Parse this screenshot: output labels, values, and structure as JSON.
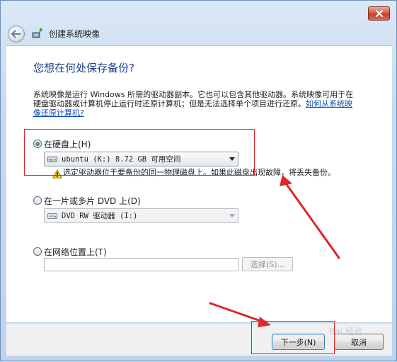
{
  "window": {
    "title": "创建系统映像",
    "close_icon": "close-x-icon"
  },
  "page": {
    "heading": "您想在何处保存备份?",
    "description": "系统映像是运行 Windows 所需的驱动器副本。它也可以包含其他驱动器。系统映像可用于在硬盘驱动器或计算机停止运行时还原计算机；但是无法选择单个项目进行还原。",
    "description_link": "如何从系统映像还原计算机?"
  },
  "options": {
    "hard_disk": {
      "label": "在硬盘上(H)",
      "checked": true,
      "selected_drive": "ubuntu (K:)  8.72 GB 可用空间",
      "drive_icon": "hard-drive-icon"
    },
    "warning": {
      "icon": "warning-icon",
      "text": "选定驱动器位于要备份的同一物理磁盘上。如果此磁盘出现故障，将丢失备份。"
    },
    "dvd": {
      "label": "在一片或多片 DVD 上(D)",
      "checked": false,
      "selected_drive": "DVD RW 驱动器  (I:)",
      "drive_icon": "dvd-drive-icon"
    },
    "network": {
      "label": "在网络位置上(T)",
      "checked": false,
      "value": "",
      "browse_label": "选择(S)..."
    }
  },
  "footer": {
    "next_label": "下一步(N)",
    "cancel_label": "取消"
  },
  "watermark": "Bai 经验",
  "colors": {
    "heading": "#1c3e8c",
    "link": "#0a49b6",
    "annotation": "#e02626"
  }
}
